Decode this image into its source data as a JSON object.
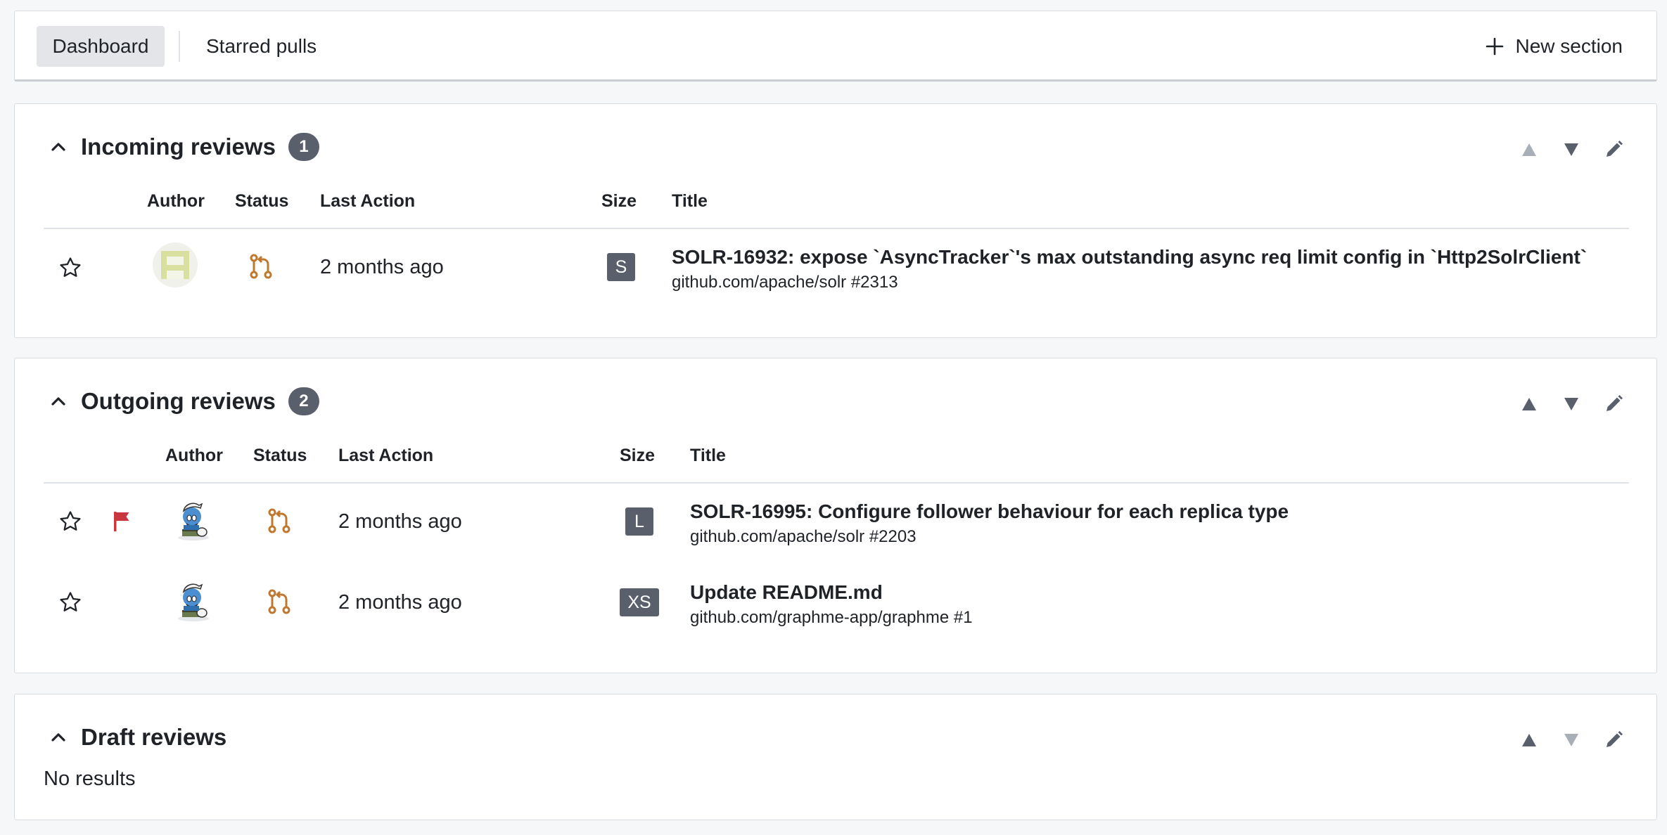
{
  "nav": {
    "tabs": [
      {
        "label": "Dashboard",
        "active": true
      },
      {
        "label": "Starred pulls",
        "active": false
      }
    ],
    "new_section_label": "New section"
  },
  "columns": {
    "author": "Author",
    "status": "Status",
    "last_action": "Last Action",
    "size": "Size",
    "title": "Title"
  },
  "sections": {
    "incoming": {
      "title": "Incoming reviews",
      "count": "1",
      "rows": [
        {
          "starred": false,
          "flagged": false,
          "author_icon": "avatar-identicon-icon",
          "status_icon": "pull-request-icon",
          "last_action": "2 months ago",
          "size": "S",
          "title": "SOLR-16932: expose `AsyncTracker`'s max outstanding async req limit config in `Http2SolrClient`",
          "repo": "github.com/apache/solr #2313"
        }
      ]
    },
    "outgoing": {
      "title": "Outgoing reviews",
      "count": "2",
      "rows": [
        {
          "starred": false,
          "flagged": true,
          "author_icon": "avatar-smurf-icon",
          "status_icon": "pull-request-icon",
          "last_action": "2 months ago",
          "size": "L",
          "title": "SOLR-16995: Configure follower behaviour for each replica type",
          "repo": "github.com/apache/solr #2203"
        },
        {
          "starred": false,
          "flagged": false,
          "author_icon": "avatar-smurf-icon",
          "status_icon": "pull-request-icon",
          "last_action": "2 months ago",
          "size": "XS",
          "title": "Update README.md",
          "repo": "github.com/graphme-app/graphme #1"
        }
      ]
    },
    "draft": {
      "title": "Draft reviews",
      "empty_text": "No results"
    }
  },
  "colors": {
    "badge_bg": "#59606b",
    "status_orange": "#c0772e",
    "flag_red": "#c9383f",
    "arrow_active": "#59606b",
    "arrow_disabled": "#a9afb7"
  }
}
